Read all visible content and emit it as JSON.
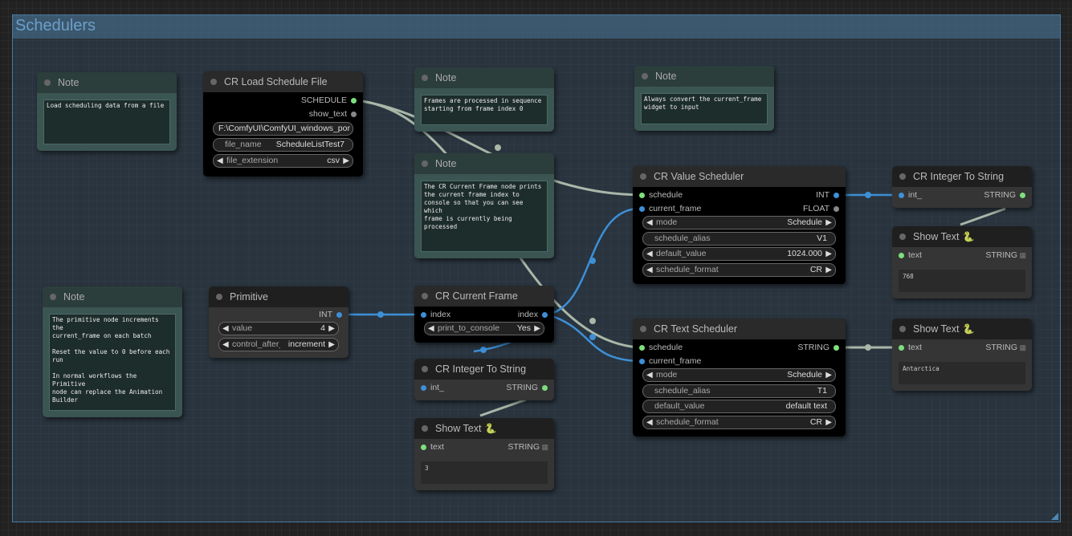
{
  "group": {
    "title": "Schedulers"
  },
  "colors": {
    "int_link": "#3d8fd6",
    "link": "#a9b7a9",
    "canvas": "#222222",
    "group": "#4a7aa0"
  },
  "nodes": {
    "note1": {
      "title": "Note",
      "text": "Load scheduling data from a file"
    },
    "load_schedule": {
      "title": "CR Load Schedule File",
      "outputs": [
        "SCHEDULE",
        "show_text"
      ],
      "input_folder": "F:\\ComfyUI\\ComfyUI_windows_por",
      "file_name_label": "file_name",
      "file_name": "ScheduleListTest7",
      "file_extension_label": "file_extension",
      "file_extension": "csv"
    },
    "note2": {
      "title": "Note",
      "text": "Frames are processed in sequence\nstarting from frame index 0"
    },
    "note3": {
      "title": "Note",
      "text": "The CR Current Frame node prints\nthe current frame index to\nconsole so that you can see which\nframe is currently being\nprocessed"
    },
    "note4": {
      "title": "Note",
      "text": "Always convert the current_frame\nwidget to input"
    },
    "value_scheduler": {
      "title": "CR Value Scheduler",
      "in_schedule": "schedule",
      "in_frame": "current_frame",
      "out_int": "INT",
      "out_float": "FLOAT",
      "mode_label": "mode",
      "mode": "Schedule",
      "alias_label": "schedule_alias",
      "alias": "V1",
      "default_label": "default_value",
      "default": "1024.000",
      "format_label": "schedule_format",
      "format": "CR"
    },
    "int_to_string1": {
      "title": "CR Integer To String",
      "in": "int_",
      "out": "STRING"
    },
    "show_text1": {
      "title": "Show Text",
      "icon": "snake-icon",
      "in": "text",
      "type": "STRING",
      "value": "768"
    },
    "note5": {
      "title": "Note",
      "text": "The primitive node increments the\ncurrent_frame on each batch\n\nReset the value to 0 before each\nrun\n\nIn normal workflows the Primitive\nnode can replace the Animation\nBuilder"
    },
    "primitive": {
      "title": "Primitive",
      "out": "INT",
      "value_label": "value",
      "value": "4",
      "control_label": "control_after_generate",
      "control": "increment"
    },
    "current_frame": {
      "title": "CR Current Frame",
      "in": "index",
      "out": "index",
      "print_label": "print_to_console",
      "print": "Yes"
    },
    "int_to_string2": {
      "title": "CR Integer To String",
      "in": "int_",
      "out": "STRING"
    },
    "show_text2": {
      "title": "Show Text",
      "icon": "snake-icon",
      "in": "text",
      "type": "STRING",
      "value": "3"
    },
    "text_scheduler": {
      "title": "CR Text Scheduler",
      "in_schedule": "schedule",
      "in_frame": "current_frame",
      "out_string": "STRING",
      "mode_label": "mode",
      "mode": "Schedule",
      "alias_label": "schedule_alias",
      "alias": "T1",
      "default_label": "default_value",
      "default": "default text",
      "format_label": "schedule_format",
      "format": "CR"
    },
    "show_text3": {
      "title": "Show Text",
      "icon": "snake-icon",
      "in": "text",
      "type": "STRING",
      "value": "Antarctica"
    }
  }
}
